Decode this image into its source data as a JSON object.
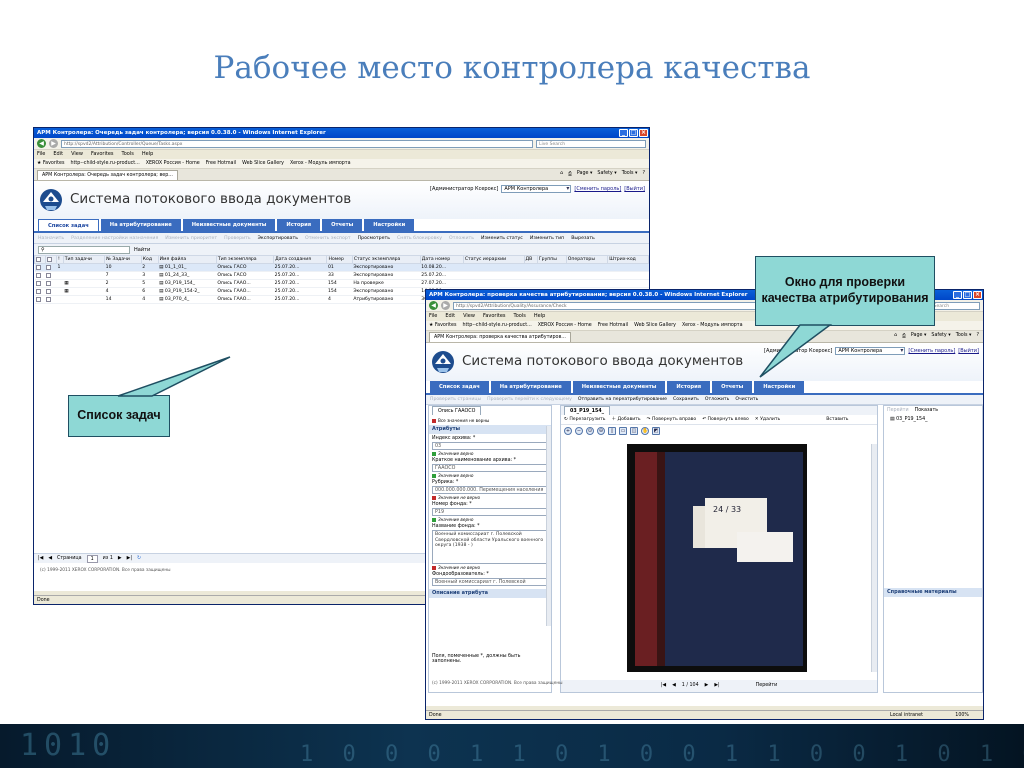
{
  "slide": {
    "title": "Рабочее место контролера качества",
    "callout_tasks": "Список задач",
    "callout_attr": "Окно для проверки качества атрибутирования"
  },
  "win1": {
    "title": "АРМ Контролера: Очередь задач контролера; версия 0.0.38.0 - Windows Internet Explorer",
    "url": "http://spvd2/Attribution/Controller/Queue/Tasks.aspx",
    "search_placeholder": "Live Search",
    "menu": [
      "File",
      "Edit",
      "View",
      "Favorites",
      "Tools",
      "Help"
    ],
    "favorites": [
      "Favorites",
      "http--child-style.ru-product...",
      "XEROX Россия - Home",
      "Free Hotmail",
      "Web Slice Gallery",
      "Xerox - Модуль импорта"
    ],
    "tab_label": "АРМ Контролера: Очередь задач контролера; вер...",
    "tab_tools": [
      "Page",
      "Safety",
      "Tools"
    ],
    "app_title": "Система потокового ввода документов",
    "user_label": "[Администратор Ксерокс]",
    "role": "АРМ Контролера",
    "change_password": "[Сменить пароль]",
    "logout": "[Выйти]",
    "navtabs": [
      "Список задач",
      "На атрибутирование",
      "Неизвестные документы",
      "История",
      "Отчеты",
      "Настройки"
    ],
    "toolbar": [
      {
        "label": "Назначить",
        "enabled": false
      },
      {
        "label": "Разделение настройки назначения",
        "enabled": false
      },
      {
        "label": "Изменить приоритет",
        "enabled": false
      },
      {
        "label": "Проверить",
        "enabled": false
      },
      {
        "label": "Экспортировать",
        "enabled": true
      },
      {
        "label": "Отменить экспорт",
        "enabled": false
      },
      {
        "label": "Просмотреть",
        "enabled": true
      },
      {
        "label": "Снять блокировку",
        "enabled": false
      },
      {
        "label": "Отложить",
        "enabled": false
      },
      {
        "label": "Изменить статус",
        "enabled": true
      },
      {
        "label": "Изменить тип",
        "enabled": true
      },
      {
        "label": "Вырезать",
        "enabled": true
      }
    ],
    "find_button": "Найти",
    "columns": [
      "",
      "",
      "!",
      "Тип задачи",
      "№ Задачи",
      "Код",
      "Имя файла",
      "Тип экземпляра",
      "Дата создания",
      "Номер",
      "Статус экземпляра",
      "Дата номер",
      "Статус иерархии",
      "ДВ",
      "Группы",
      "Операторы",
      "Штрих-код"
    ],
    "rows": [
      [
        "",
        "1",
        "",
        "10",
        "2",
        "01_1_01_",
        "Опись ГАСО",
        "25.07.20...",
        "01",
        "Экспортировано",
        "10.08.20..."
      ],
      [
        "",
        "",
        "",
        "7",
        "3",
        "01_24_33_",
        "Опись ГАСО",
        "25.07.20...",
        "33",
        "Экспортировано",
        "25.07.20..."
      ],
      [
        "",
        "",
        "",
        "2",
        "5",
        "03_P19_154_",
        "Опись ГААО...",
        "25.07.20...",
        "154",
        "На проверке",
        "27.07.20..."
      ],
      [
        "",
        "",
        "",
        "4",
        "6",
        "03_P19_154-2_",
        "Опись ГААО...",
        "25.07.20...",
        "154",
        "Экспортировано",
        "14.08.20..."
      ],
      [
        "",
        "",
        "",
        "14",
        "4",
        "03_P70_4_",
        "Опись ГААО...",
        "25.07.20...",
        "4",
        "Атрибутировано",
        "30.08.20..."
      ]
    ],
    "pager": {
      "page_label": "Страница",
      "page": "1",
      "of": "из 1"
    },
    "copyright": "(c) 1999-2011 XEROX CORPORATION. Все права защищены",
    "status": "Done"
  },
  "win2": {
    "title": "АРМ Контролера: проверка качества атрибутирования; версия 0.0.38.0 - Windows Internet Explorer",
    "url": "http://spvd2/Attribution/Quality/Assurance/Check",
    "search_placeholder": "Live Search",
    "menu": [
      "File",
      "Edit",
      "View",
      "Favorites",
      "Tools",
      "Help"
    ],
    "favorites": [
      "Favorites",
      "http--child-style.ru-product...",
      "XEROX Россия - Home",
      "Free Hotmail",
      "Web Slice Gallery",
      "Xerox - Модуль импорта"
    ],
    "tab_label": "АРМ Контролера: проверка качества атрибутиров...",
    "tab_tools": [
      "Page",
      "Safety",
      "Tools"
    ],
    "app_title": "Система потокового ввода документов",
    "user_label": "[Администратор Ксерокс]",
    "role": "АРМ Контролера",
    "change_password": "[Сменить пароль]",
    "logout": "[Выйти]",
    "navtabs": [
      "Список задач",
      "На атрибутирование",
      "Неизвестные документы",
      "История",
      "Отчеты",
      "Настройки"
    ],
    "toolbar": [
      {
        "label": "Проверить страницы",
        "enabled": false
      },
      {
        "label": "Проверить перейти к следующему",
        "enabled": false
      },
      {
        "label": "Отправить на переатрибутирование",
        "enabled": true
      },
      {
        "label": "Сохранить",
        "enabled": true
      },
      {
        "label": "Отложить",
        "enabled": true
      },
      {
        "label": "Очистить",
        "enabled": true
      }
    ],
    "left_tab": "Опись ГААОСО",
    "all_correct": "Все значения не верны",
    "attributes_head": "Атрибуты",
    "valid_text": "Значение верно",
    "invalid_text": "Значение не верно",
    "fields": [
      {
        "label": "Индекс архива:",
        "value": "03",
        "status": "valid"
      },
      {
        "label": "Краткое наименование архива:",
        "value": "ГААОСО",
        "status": "valid"
      },
      {
        "label": "Рубрика:",
        "value": "000.000.000.000. Перемещения населения",
        "status": "invalid"
      },
      {
        "label": "Номер фонда:",
        "value": "P19",
        "status": "valid"
      },
      {
        "label": "Название фонда:",
        "value": "Военный комиссариат г. Полевской Свердловской области Уральского военного округа (1938 - )",
        "status": "invalid"
      },
      {
        "label": "Фондообразователь:",
        "value": "Военный комиссариат г. Полевской",
        "status": ""
      }
    ],
    "desc_head": "Описание атрибута",
    "required_note": "Поля, помеченные *, должны быть заполнены.",
    "viewer_tab": "03_P19_154_",
    "viewer_tools": [
      "Перезагрузить",
      "Добавить",
      "Повернуть вправо",
      "Повернуть влево",
      "Удалить"
    ],
    "insert_label": "Вставить",
    "doc_label": "24 / 33",
    "page_counter": "1 / 104",
    "goto": "Перейти",
    "right_tools": [
      "Перейти",
      "Показать"
    ],
    "right_item": "03_P19_154_",
    "ref_materials": "Справочные материалы",
    "copyright": "(c) 1999-2011 XEROX CORPORATION. Все права защищены",
    "status": "Done",
    "zone": "Local intranet",
    "zoom": "100%"
  }
}
